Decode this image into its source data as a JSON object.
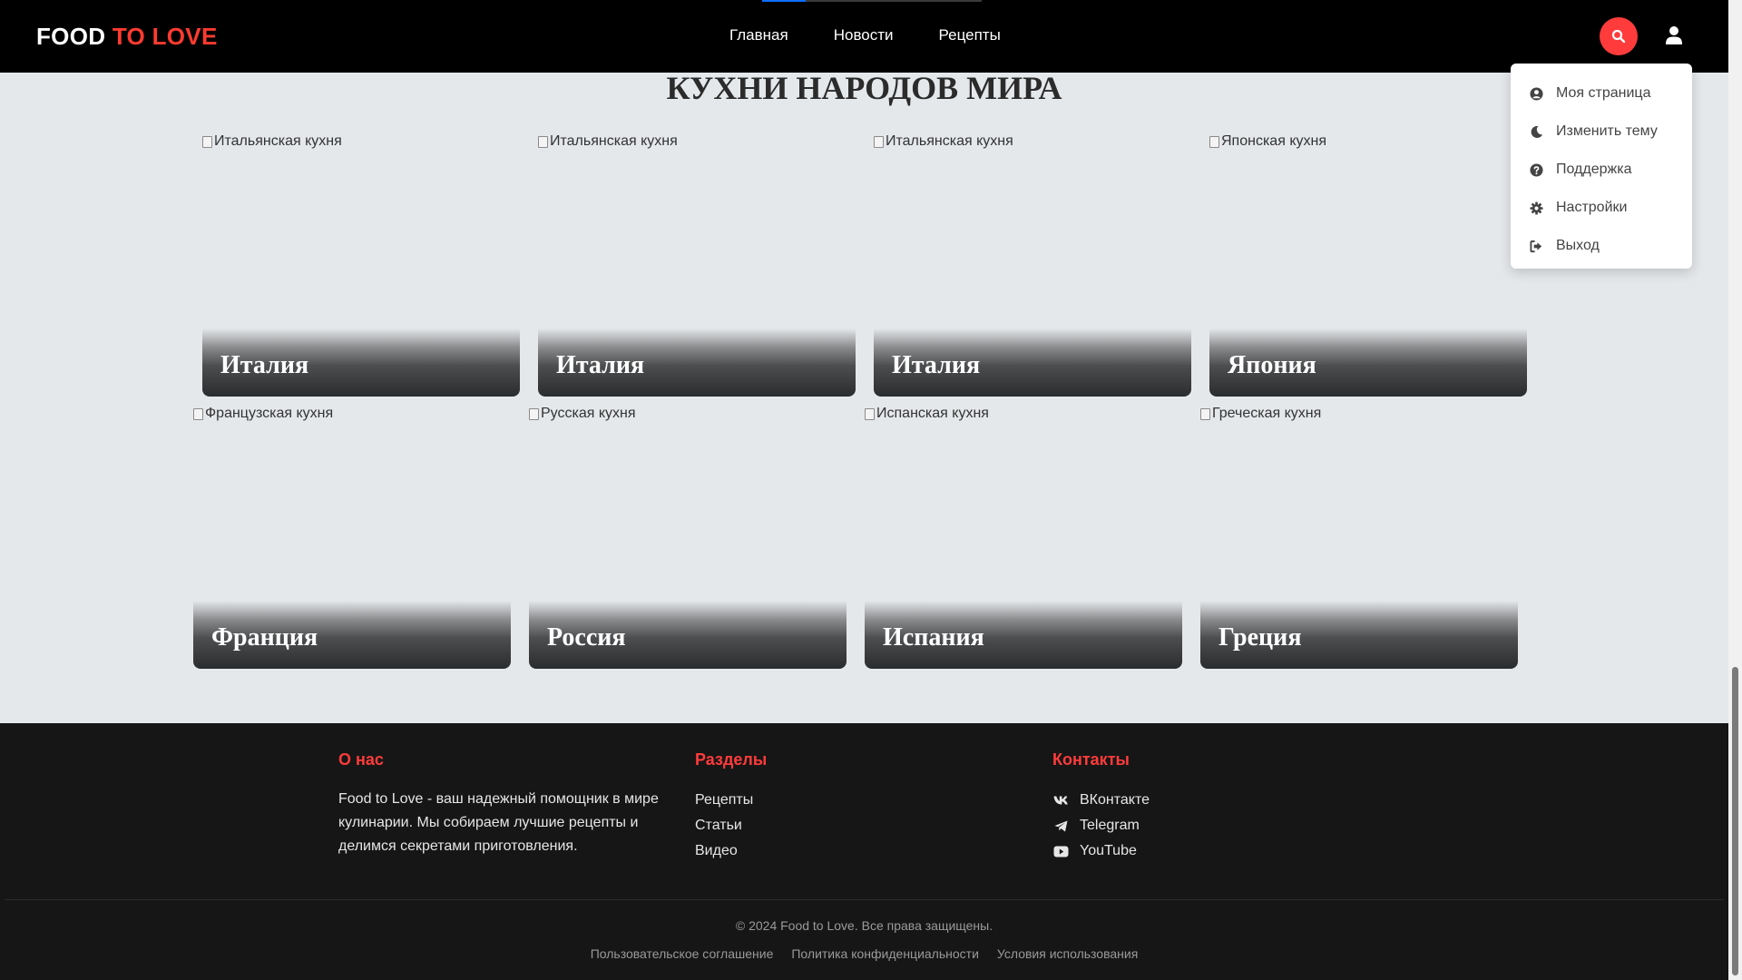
{
  "header": {
    "logo_part1": "FOOD",
    "logo_part2": "TO LOVE",
    "nav": [
      "Главная",
      "Новости",
      "Рецепты"
    ],
    "nav_progress": 0.2,
    "search_icon": "search-icon",
    "user_icon": "user-icon"
  },
  "user_menu": {
    "items": [
      {
        "label": "Моя страница",
        "icon": "user-circle-icon"
      },
      {
        "label": "Изменить тему",
        "icon": "moon-icon"
      },
      {
        "label": "Поддержка",
        "icon": "question-circle-icon"
      },
      {
        "label": "Настройки",
        "icon": "gear-icon"
      },
      {
        "label": "Выход",
        "icon": "sign-out-icon"
      }
    ]
  },
  "main": {
    "title": "КУХНИ НАРОДОВ МИРА",
    "cards": [
      {
        "alt": "Итальянская кухня",
        "name": "Италия"
      },
      {
        "alt": "Итальянская кухня",
        "name": "Италия"
      },
      {
        "alt": "Итальянская кухня",
        "name": "Италия"
      },
      {
        "alt": "Японская кухня",
        "name": "Япония"
      },
      {
        "alt": "Французская кухня",
        "name": "Франция"
      },
      {
        "alt": "Русская кухня",
        "name": "Россия"
      },
      {
        "alt": "Испанская кухня",
        "name": "Испания"
      },
      {
        "alt": "Греческая кухня",
        "name": "Греция"
      }
    ]
  },
  "footer": {
    "about": {
      "heading": "О нас",
      "text": "Food to Love - ваш надежный помощник в мире кулинарии. Мы собираем лучшие рецепты и делимся секретами приготовления."
    },
    "sections": {
      "heading": "Разделы",
      "links": [
        "Рецепты",
        "Статьи",
        "Видео"
      ]
    },
    "contacts": {
      "heading": "Контакты",
      "links": [
        {
          "label": "ВКонтакте",
          "icon": "vk-icon"
        },
        {
          "label": "Telegram",
          "icon": "telegram-icon"
        },
        {
          "label": "YouTube",
          "icon": "youtube-icon"
        }
      ]
    },
    "copyright": "© 2024 Food to Love. Все права защищены.",
    "legal": [
      "Пользовательское соглашение",
      "Политика конфиденциальности",
      "Условия использования"
    ]
  },
  "colors": {
    "accent": "#ff3b3b",
    "header_bg": "#000000",
    "page_bg": "#e5e8eb",
    "footer_bg": "#161616"
  }
}
